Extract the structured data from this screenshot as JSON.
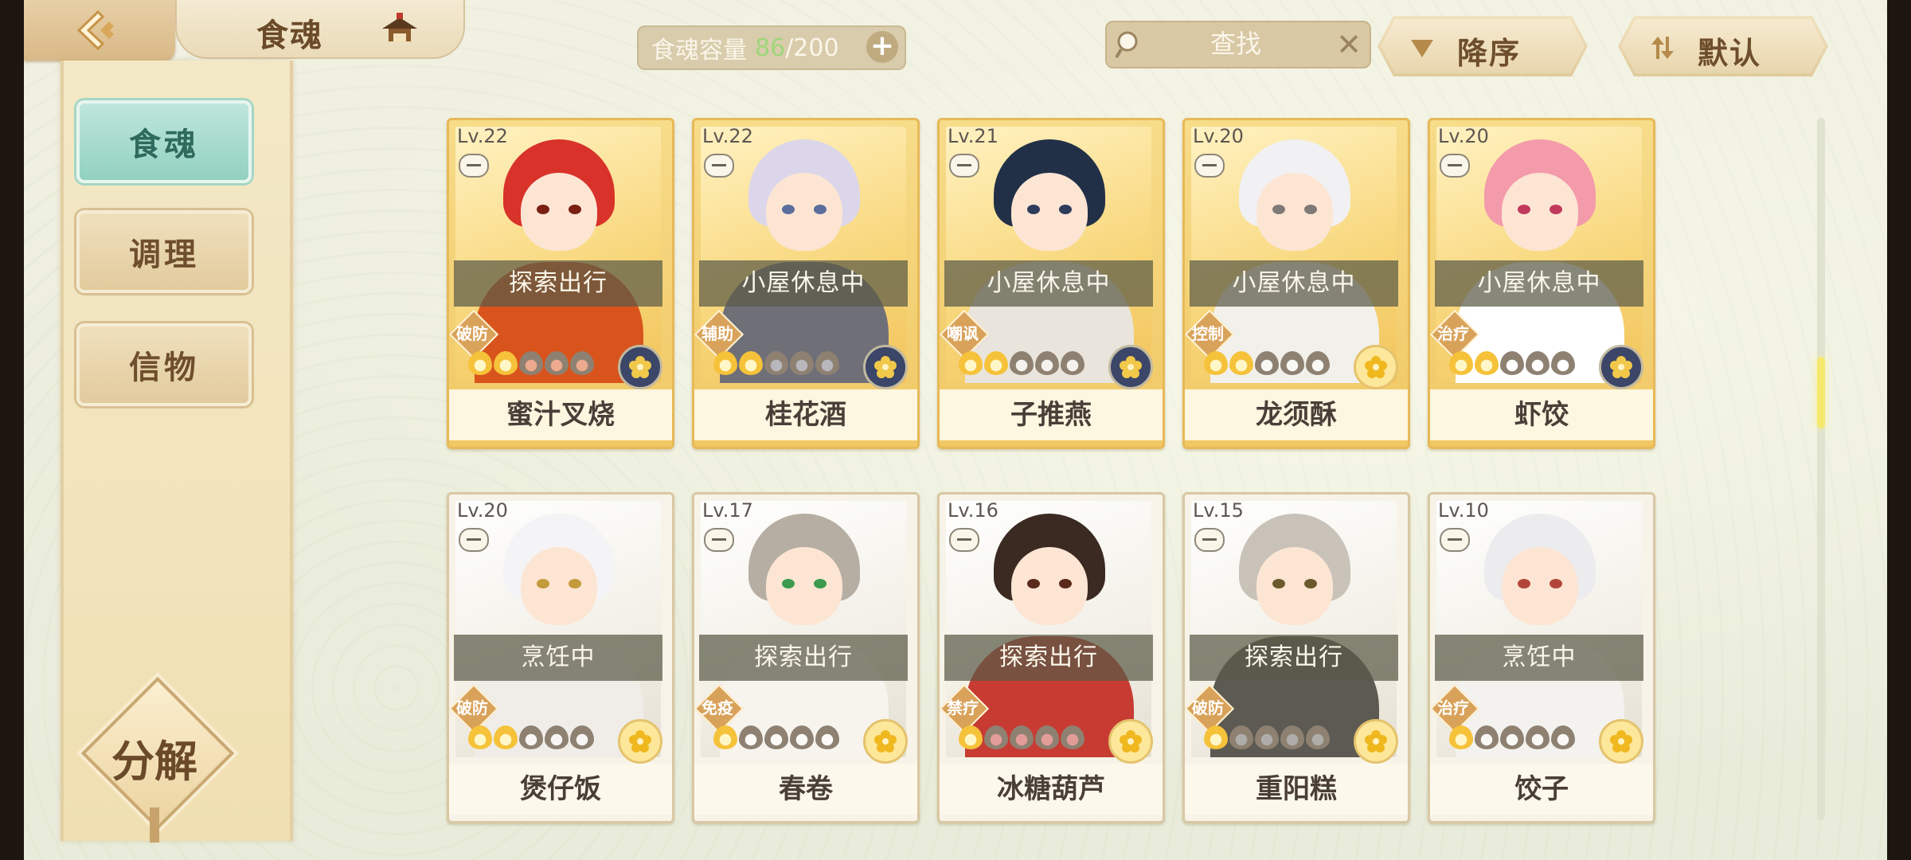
{
  "header": {
    "title": "食魂",
    "capacity_label": "食魂容量",
    "capacity_current": "86",
    "capacity_max": "/200",
    "search_placeholder": "查找",
    "sort_order": "降序",
    "sort_mode": "默认"
  },
  "sidebar": {
    "items": [
      {
        "label": "食魂",
        "active": true
      },
      {
        "label": "调理",
        "active": false
      },
      {
        "label": "信物",
        "active": false
      }
    ],
    "decompose_label": "分解"
  },
  "colors": {
    "active_tab": "#92d1c0",
    "gold_card": "#f1c864",
    "capacity_current": "#9ed67a"
  },
  "cards": [
    {
      "level": "Lv.22",
      "status": "探索出行",
      "role": "破防",
      "name": "蜜汁叉烧",
      "stars": 2,
      "frame": "gold",
      "badge": "dark"
    },
    {
      "level": "Lv.22",
      "status": "小屋休息中",
      "role": "辅助",
      "name": "桂花酒",
      "stars": 2,
      "frame": "gold",
      "badge": "dark"
    },
    {
      "level": "Lv.21",
      "status": "小屋休息中",
      "role": "嘲讽",
      "name": "子推燕",
      "stars": 2,
      "frame": "gold",
      "badge": "dark"
    },
    {
      "level": "Lv.20",
      "status": "小屋休息中",
      "role": "控制",
      "name": "龙须酥",
      "stars": 2,
      "frame": "gold",
      "badge": "gold"
    },
    {
      "level": "Lv.20",
      "status": "小屋休息中",
      "role": "治疗",
      "name": "虾饺",
      "stars": 2,
      "frame": "gold",
      "badge": "dark"
    },
    {
      "level": "Lv.20",
      "status": "烹饪中",
      "role": "破防",
      "name": "煲仔饭",
      "stars": 2,
      "frame": "silver",
      "badge": "gold"
    },
    {
      "level": "Lv.17",
      "status": "探索出行",
      "role": "免疫",
      "name": "春卷",
      "stars": 1,
      "frame": "silver",
      "badge": "gold"
    },
    {
      "level": "Lv.16",
      "status": "探索出行",
      "role": "禁疗",
      "name": "冰糖葫芦",
      "stars": 1,
      "frame": "silver",
      "badge": "gold"
    },
    {
      "level": "Lv.15",
      "status": "探索出行",
      "role": "破防",
      "name": "重阳糕",
      "stars": 1,
      "frame": "silver",
      "badge": "gold"
    },
    {
      "level": "Lv.10",
      "status": "烹饪中",
      "role": "治疗",
      "name": "饺子",
      "stars": 1,
      "frame": "silver",
      "badge": "gold"
    }
  ]
}
